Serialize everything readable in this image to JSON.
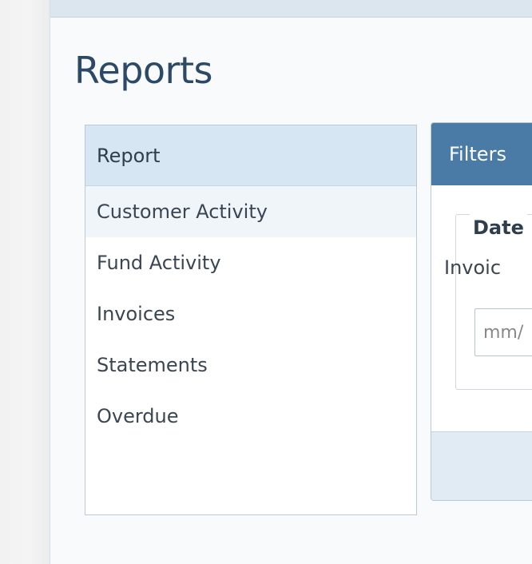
{
  "page": {
    "title": "Reports"
  },
  "report_panel": {
    "header": "Report",
    "items": [
      {
        "label": "Customer Activity"
      },
      {
        "label": "Fund Activity"
      },
      {
        "label": "Invoices"
      },
      {
        "label": "Statements"
      },
      {
        "label": "Overdue"
      }
    ]
  },
  "filters": {
    "header": "Filters",
    "group_legend": "Date",
    "field_label": "Invoic",
    "date_input_placeholder": "mm/",
    "date_input_value": ""
  },
  "colors": {
    "accent": "#4a7ba6",
    "title": "#2c4a66",
    "panel_header_bg": "#d6e6f2",
    "active_row_bg": "#f0f5fa"
  }
}
